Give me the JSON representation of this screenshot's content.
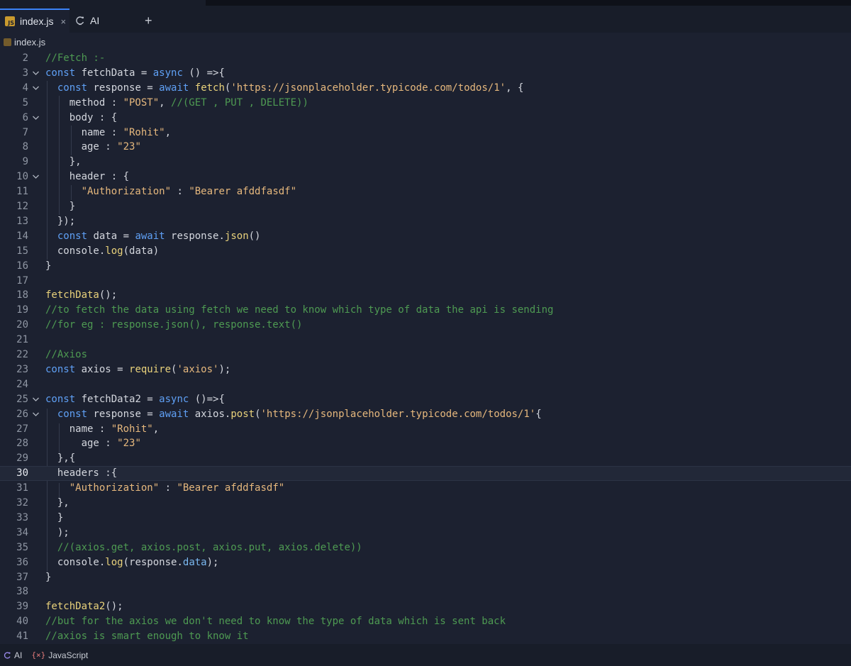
{
  "tabs": [
    {
      "label": "index.js",
      "icon": "js-file-icon",
      "active": true
    },
    {
      "label": "AI",
      "icon": "ai-icon",
      "active": false
    }
  ],
  "tab_close_glyph": "×",
  "tab_add_glyph": "+",
  "breadcrumb": {
    "file": "index.js"
  },
  "editor": {
    "current_line": 30,
    "lines": [
      {
        "n": "2",
        "fold": false,
        "tokens": [
          [
            "com",
            "//Fetch :-"
          ]
        ]
      },
      {
        "n": "3",
        "fold": true,
        "tokens": [
          [
            "kw",
            "const"
          ],
          [
            "pl",
            " fetchData = "
          ],
          [
            "kw",
            "async"
          ],
          [
            "pl",
            " () =>{"
          ]
        ]
      },
      {
        "n": "4",
        "fold": true,
        "tokens": [
          [
            "pl",
            "  "
          ],
          [
            "kw",
            "const"
          ],
          [
            "pl",
            " response = "
          ],
          [
            "kw",
            "await"
          ],
          [
            "pl",
            " "
          ],
          [
            "fn",
            "fetch"
          ],
          [
            "pl",
            "("
          ],
          [
            "str",
            "'https://jsonplaceholder.typicode.com/todos/1'"
          ],
          [
            "pl",
            ", {"
          ]
        ]
      },
      {
        "n": "5",
        "fold": false,
        "tokens": [
          [
            "pl",
            "    method : "
          ],
          [
            "str",
            "\"POST\""
          ],
          [
            "pl",
            ", "
          ],
          [
            "com",
            "//(GET , PUT , DELETE))"
          ]
        ]
      },
      {
        "n": "6",
        "fold": true,
        "tokens": [
          [
            "pl",
            "    body : {"
          ]
        ]
      },
      {
        "n": "7",
        "fold": false,
        "tokens": [
          [
            "pl",
            "      name : "
          ],
          [
            "str",
            "\"Rohit\""
          ],
          [
            "pl",
            ","
          ]
        ]
      },
      {
        "n": "8",
        "fold": false,
        "tokens": [
          [
            "pl",
            "      age : "
          ],
          [
            "str",
            "\"23\""
          ]
        ]
      },
      {
        "n": "9",
        "fold": false,
        "tokens": [
          [
            "pl",
            "    },"
          ]
        ]
      },
      {
        "n": "10",
        "fold": true,
        "tokens": [
          [
            "pl",
            "    header : {"
          ]
        ]
      },
      {
        "n": "11",
        "fold": false,
        "tokens": [
          [
            "pl",
            "      "
          ],
          [
            "str",
            "\"Authorization\""
          ],
          [
            "pl",
            " : "
          ],
          [
            "str",
            "\"Bearer afddfasdf\""
          ]
        ]
      },
      {
        "n": "12",
        "fold": false,
        "tokens": [
          [
            "pl",
            "    }"
          ]
        ]
      },
      {
        "n": "13",
        "fold": false,
        "tokens": [
          [
            "pl",
            "  });"
          ]
        ]
      },
      {
        "n": "14",
        "fold": false,
        "tokens": [
          [
            "pl",
            "  "
          ],
          [
            "kw",
            "const"
          ],
          [
            "pl",
            " data = "
          ],
          [
            "kw",
            "await"
          ],
          [
            "pl",
            " response."
          ],
          [
            "fn",
            "json"
          ],
          [
            "pl",
            "()"
          ]
        ]
      },
      {
        "n": "15",
        "fold": false,
        "tokens": [
          [
            "pl",
            "  console."
          ],
          [
            "fn",
            "log"
          ],
          [
            "pl",
            "(data)"
          ]
        ]
      },
      {
        "n": "16",
        "fold": false,
        "tokens": [
          [
            "pl",
            "}"
          ]
        ]
      },
      {
        "n": "17",
        "fold": false,
        "tokens": []
      },
      {
        "n": "18",
        "fold": false,
        "tokens": [
          [
            "fn",
            "fetchData"
          ],
          [
            "pl",
            "();"
          ]
        ]
      },
      {
        "n": "19",
        "fold": false,
        "tokens": [
          [
            "com",
            "//to fetch the data using fetch we need to know which type of data the api is sending"
          ]
        ]
      },
      {
        "n": "20",
        "fold": false,
        "tokens": [
          [
            "com",
            "//for eg : response.json(), response.text()"
          ]
        ]
      },
      {
        "n": "21",
        "fold": false,
        "tokens": []
      },
      {
        "n": "22",
        "fold": false,
        "tokens": [
          [
            "com",
            "//Axios"
          ]
        ]
      },
      {
        "n": "23",
        "fold": false,
        "tokens": [
          [
            "kw",
            "const"
          ],
          [
            "pl",
            " axios = "
          ],
          [
            "fn",
            "require"
          ],
          [
            "pl",
            "("
          ],
          [
            "str",
            "'axios'"
          ],
          [
            "pl",
            ");"
          ]
        ]
      },
      {
        "n": "24",
        "fold": false,
        "tokens": []
      },
      {
        "n": "25",
        "fold": true,
        "tokens": [
          [
            "kw",
            "const"
          ],
          [
            "pl",
            " fetchData2 = "
          ],
          [
            "kw",
            "async"
          ],
          [
            "pl",
            " ()=>{"
          ]
        ]
      },
      {
        "n": "26",
        "fold": true,
        "tokens": [
          [
            "pl",
            "  "
          ],
          [
            "kw",
            "const"
          ],
          [
            "pl",
            " response = "
          ],
          [
            "kw",
            "await"
          ],
          [
            "pl",
            " axios."
          ],
          [
            "fn",
            "post"
          ],
          [
            "pl",
            "("
          ],
          [
            "str",
            "'https://jsonplaceholder.typicode.com/todos/1'"
          ],
          [
            "pl",
            "{"
          ]
        ]
      },
      {
        "n": "27",
        "fold": false,
        "tokens": [
          [
            "pl",
            "    name : "
          ],
          [
            "str",
            "\"Rohit\""
          ],
          [
            "pl",
            ","
          ]
        ]
      },
      {
        "n": "28",
        "fold": false,
        "tokens": [
          [
            "pl",
            "      age : "
          ],
          [
            "str",
            "\"23\""
          ]
        ]
      },
      {
        "n": "29",
        "fold": false,
        "tokens": [
          [
            "pl",
            "  },{"
          ]
        ]
      },
      {
        "n": "30",
        "fold": false,
        "tokens": [
          [
            "pl",
            "  headers :{"
          ]
        ]
      },
      {
        "n": "31",
        "fold": false,
        "tokens": [
          [
            "pl",
            "    "
          ],
          [
            "str",
            "\"Authorization\""
          ],
          [
            "pl",
            " : "
          ],
          [
            "str",
            "\"Bearer afddfasdf\""
          ]
        ]
      },
      {
        "n": "32",
        "fold": false,
        "tokens": [
          [
            "pl",
            "  },"
          ]
        ]
      },
      {
        "n": "33",
        "fold": false,
        "tokens": [
          [
            "pl",
            "  }"
          ]
        ]
      },
      {
        "n": "34",
        "fold": false,
        "tokens": [
          [
            "pl",
            "  );"
          ]
        ]
      },
      {
        "n": "35",
        "fold": false,
        "tokens": [
          [
            "pl",
            "  "
          ],
          [
            "com",
            "//(axios.get, axios.post, axios.put, axios.delete))"
          ]
        ]
      },
      {
        "n": "36",
        "fold": false,
        "tokens": [
          [
            "pl",
            "  console."
          ],
          [
            "fn",
            "log"
          ],
          [
            "pl",
            "(response."
          ],
          [
            "prop",
            "data"
          ],
          [
            "pl",
            ");"
          ]
        ]
      },
      {
        "n": "37",
        "fold": false,
        "tokens": [
          [
            "pl",
            "}"
          ]
        ]
      },
      {
        "n": "38",
        "fold": false,
        "tokens": []
      },
      {
        "n": "39",
        "fold": false,
        "tokens": [
          [
            "fn",
            "fetchData2"
          ],
          [
            "pl",
            "();"
          ]
        ]
      },
      {
        "n": "40",
        "fold": false,
        "tokens": [
          [
            "com",
            "//but for the axios we don't need to know the type of data which is sent back"
          ]
        ]
      },
      {
        "n": "41",
        "fold": false,
        "tokens": [
          [
            "com",
            "//axios is smart enough to know it"
          ]
        ]
      }
    ]
  },
  "statusbar": {
    "ai_label": "AI",
    "var_glyph": "{×}",
    "language": "JavaScript"
  },
  "colors": {
    "background": "#1c2130",
    "comment": "#4e9a52",
    "keyword": "#5fa0f5",
    "string": "#e6b87d",
    "function": "#e9d27b"
  }
}
